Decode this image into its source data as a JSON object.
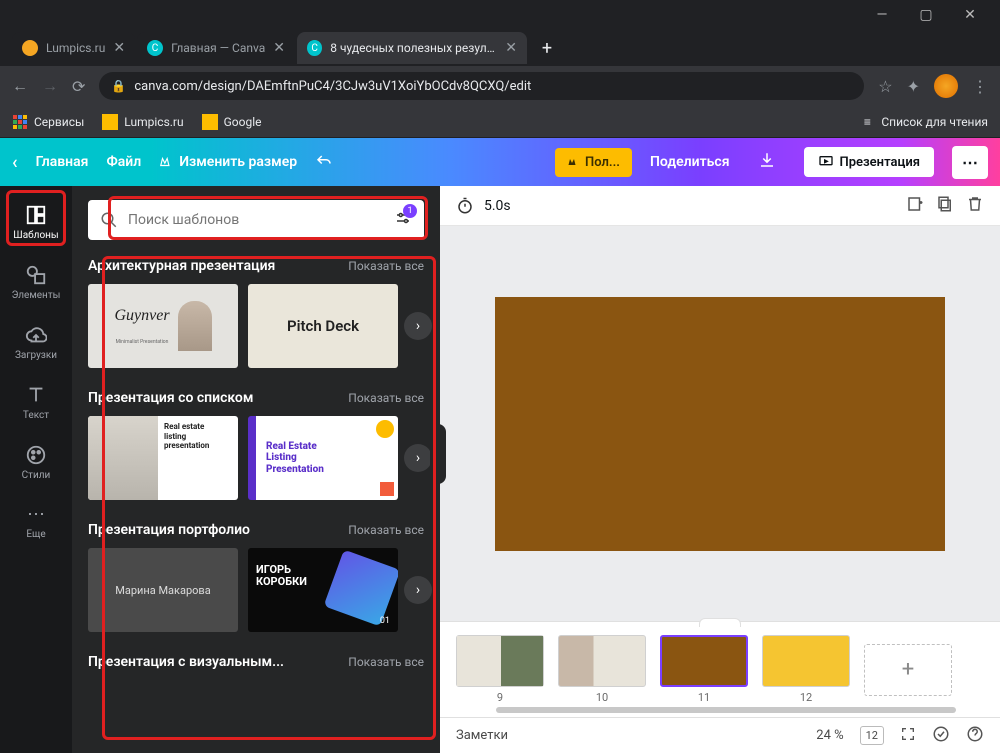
{
  "window": {
    "min": "—",
    "max": "▢",
    "close": "✕"
  },
  "tabs": [
    {
      "label": "Lumpics.ru",
      "favcolor": "#f5a623"
    },
    {
      "label": "Главная — Canva",
      "favcolor": "#00c4cc",
      "favchar": "C"
    },
    {
      "label": "8 чудесных полезных результа",
      "favcolor": "#00c4cc",
      "favchar": "C"
    }
  ],
  "url": "canva.com/design/DAEmftnPuC4/3CJw3uV1XoiYbOCdv8QCXQ/edit",
  "bookmarks": {
    "services": "Сервисы",
    "lumpics": "Lumpics.ru",
    "google": "Google",
    "reading": "Список для чтения"
  },
  "topbar": {
    "home": "Главная",
    "file": "Файл",
    "resize": "Изменить размер",
    "upgrade": "Пол...",
    "share": "Поделиться",
    "present": "Презентация"
  },
  "sidebar": [
    {
      "name": "templates",
      "label": "Шаблоны"
    },
    {
      "name": "elements",
      "label": "Элементы"
    },
    {
      "name": "uploads",
      "label": "Загрузки"
    },
    {
      "name": "text",
      "label": "Текст"
    },
    {
      "name": "styles",
      "label": "Стили"
    },
    {
      "name": "more",
      "label": "Еще"
    }
  ],
  "search": {
    "placeholder": "Поиск шаблонов",
    "badge": "1"
  },
  "sections": [
    {
      "title": "Архитектурная презентация",
      "showall": "Показать все"
    },
    {
      "title": "Презентация со списком",
      "showall": "Показать все"
    },
    {
      "title": "Презентация портфолио",
      "showall": "Показать все"
    },
    {
      "title": "Презентация с визуальным...",
      "showall": "Показать все"
    }
  ],
  "card_labels": {
    "guynver": "Guynver",
    "guynver_sub": "Minimalist Presentation",
    "pitch": "Pitch Deck",
    "re1_l1": "Real estate",
    "re1_l2": "listing",
    "re1_l3": "presentation",
    "re2_l1": "Real Estate",
    "re2_l2": "Listing",
    "re2_l3": "Presentation",
    "marina": "Марина Макарова",
    "igor_l1": "ИГОРЬ",
    "igor_l2": "КОРОБКИ",
    "igor_num": "01"
  },
  "canvas": {
    "timing": "5.0s"
  },
  "thumbs": [
    "9",
    "10",
    "11",
    "12"
  ],
  "footer": {
    "notes": "Заметки",
    "zoom": "24 %",
    "page": "12"
  }
}
